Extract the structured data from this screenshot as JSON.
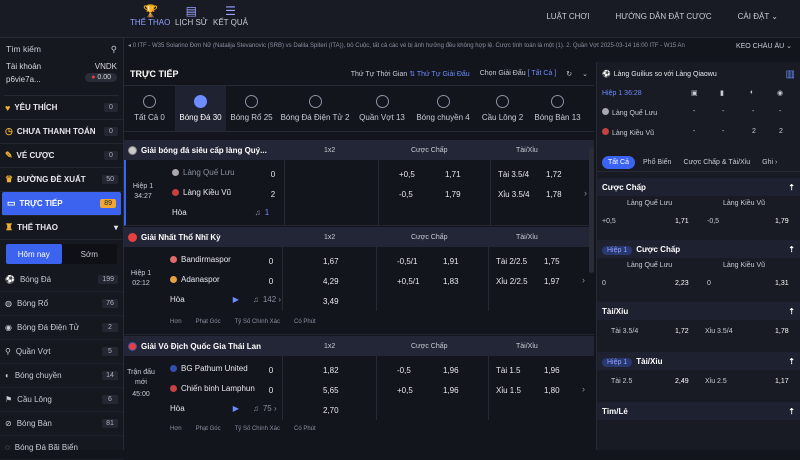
{
  "top": {
    "nav": [
      {
        "label": "THỂ THAO"
      },
      {
        "label": "LỊCH SỬ"
      },
      {
        "label": "KẾT QUẢ"
      }
    ],
    "links": [
      "LUẬT CHƠI",
      "HƯỚNG DẪN ĐẶT CƯỢC",
      "CÀI ĐẶT ⌄"
    ]
  },
  "sidebar": {
    "search": "Tìm kiếm",
    "account_label": "Tài khoản",
    "currency": "VNDK",
    "username": "p6vie7a...",
    "balance": "0.00",
    "sections": [
      {
        "label": "YÊU THÍCH",
        "count": "0"
      },
      {
        "label": "CHƯA THANH TOÁN",
        "count": "0"
      },
      {
        "label": "VÉ CƯỢC",
        "count": "0"
      },
      {
        "label": "ĐƯỜNG ĐỀ XUẤT",
        "count": "50"
      },
      {
        "label": "TRỰC TIẾP",
        "count": "89"
      },
      {
        "label": "THỂ THAO",
        "count": ""
      }
    ],
    "today": "Hôm nay",
    "early": "Sớm",
    "sports": [
      {
        "label": "Bóng Đá",
        "count": "199"
      },
      {
        "label": "Bóng Rổ",
        "count": "76"
      },
      {
        "label": "Bóng Đá Điện Tử",
        "count": "2"
      },
      {
        "label": "Quần Vợt",
        "count": "5"
      },
      {
        "label": "Bóng chuyền",
        "count": "14"
      },
      {
        "label": "Cầu Lông",
        "count": "6"
      },
      {
        "label": "Bóng Bàn",
        "count": "81"
      },
      {
        "label": "Bóng Đá Bãi Biển",
        "count": ""
      }
    ]
  },
  "ticker": {
    "text": "0 ITF - W35 Solarino Đơn Nữ (Natalija Stevanovic (SRB) vs Dalila Spiteri (ITA)), bỏ Cuộc, tất cả các vé bị ảnh hưởng đều không hợp lệ. Cược tính toán là một (1). 2. Quần Vợt 2025-03-14 16:00 ITF - W15 An",
    "region": "KÉO CHÂU ÂU ⌄"
  },
  "main": {
    "title": "TRỰC TIẾP",
    "sort_label": "Thứ Tự Thời Gian",
    "sort_value": "⇅ Thứ Tự Giải Đấu",
    "choose_league": "Chọn Giải Đấu",
    "all": "[ Tất Cả ]",
    "sport_tabs": [
      {
        "label": "Tất Cả 0"
      },
      {
        "label": "Bóng Đá 30"
      },
      {
        "label": "Bóng Rổ 25"
      },
      {
        "label": "Bóng Đá Điện Tử 2"
      },
      {
        "label": "Quần Vợt 13"
      },
      {
        "label": "Bóng chuyền 4"
      },
      {
        "label": "Cầu Lông 2"
      },
      {
        "label": "Bóng Bàn 13"
      }
    ],
    "col_1x2": "1x2",
    "col_handicap": "Cược Chấp",
    "col_ou": "Tài/Xỉu",
    "leagues": [
      {
        "name": "Giải bóng đá siêu cấp làng Quý...",
        "time1": "Hiệp 1",
        "time2": "34:27",
        "home": "Làng Quế Lưu",
        "away": "Làng Kiều Vũ",
        "draw": "Hòa",
        "hs": "0",
        "as": "2",
        "extra": "1",
        "o1": "",
        "o2": "",
        "o3": "",
        "h1": "+0,5",
        "h1o": "1,71",
        "h2": "-0,5",
        "h2o": "1,79",
        "t1": "Tài 3.5/4",
        "t1o": "1,72",
        "t2": "Xỉu 3.5/4",
        "t2o": "1,78",
        "links": []
      },
      {
        "name": "Giải Nhất Thổ Nhĩ Kỳ",
        "time1": "Hiệp 1",
        "time2": "02:12",
        "home": "Bandirmaspor",
        "away": "Adanaspor",
        "draw": "Hòa",
        "hs": "0",
        "as": "0",
        "extra": "142 ›",
        "o1": "1,67",
        "o2": "4,29",
        "o3": "3,49",
        "h1": "-0,5/1",
        "h1o": "1,91",
        "h2": "+0,5/1",
        "h2o": "1,83",
        "t1": "Tài 2/2.5",
        "t1o": "1,75",
        "t2": "Xỉu 2/2.5",
        "t2o": "1,97",
        "links": [
          "Hơn",
          "Phạt Góc",
          "Tỷ Số Chính Xác",
          "Có Phút"
        ]
      },
      {
        "name": "Giải Vô Địch Quốc Gia Thái Lan",
        "time1": "Trận đấu mới",
        "time2": "45:00",
        "home": "BG Pathum United",
        "away": "Chiến binh Lamphun",
        "draw": "Hòa",
        "hs": "0",
        "as": "0",
        "extra": "75 ›",
        "o1": "1,82",
        "o2": "5,65",
        "o3": "2,70",
        "h1": "-0,5",
        "h1o": "1,96",
        "h2": "+0,5",
        "h2o": "1,96",
        "t1": "Tài 1.5",
        "t1o": "1,96",
        "t2": "Xỉu 1.5",
        "t2o": "1,80",
        "links": [
          "Hơn",
          "Phạt Góc",
          "Tỷ Số Chính Xác",
          "Có Phút"
        ]
      }
    ]
  },
  "right": {
    "title": "Làng Guilius so với Làng Qiaowu",
    "period": "Hiệp 1 36:28",
    "home": "Làng Quế Lưu",
    "away": "Làng Kiều Vũ",
    "home_scores": [
      "-",
      "-",
      "-",
      "-"
    ],
    "away_scores": [
      "-",
      "-",
      "2",
      "2"
    ],
    "tabs": [
      "Tất Cả",
      "Phổ Biến",
      "Cược Chấp & Tài/Xỉu",
      "Ghi ›"
    ],
    "sec_handicap": "Cược Chấp",
    "sec_handicap_h1": "Cược Chấp",
    "sec_ou": "Tài/Xỉu",
    "sec_ou_h1": "Tài/Xỉu",
    "sec_oe": "Tỉm/Lẻ",
    "pill": "Hiệp 1",
    "r1": {
      "h": "+0,5",
      "ho": "1,71",
      "a": "-0,5",
      "ao": "1,79"
    },
    "r2": {
      "h": "0",
      "ho": "2,23",
      "a": "0",
      "ao": "1,31"
    },
    "r3": {
      "h": "Tài 3.5/4",
      "ho": "1,72",
      "a": "Xỉu 3.5/4",
      "ao": "1,78"
    },
    "r4": {
      "h": "Tài 2.5",
      "ho": "2,49",
      "a": "Xỉu 2.5",
      "ao": "1,17"
    }
  },
  "colors": {
    "accent": "#3b63f0",
    "live_count": "#f0a832",
    "bg": "#13151c"
  }
}
